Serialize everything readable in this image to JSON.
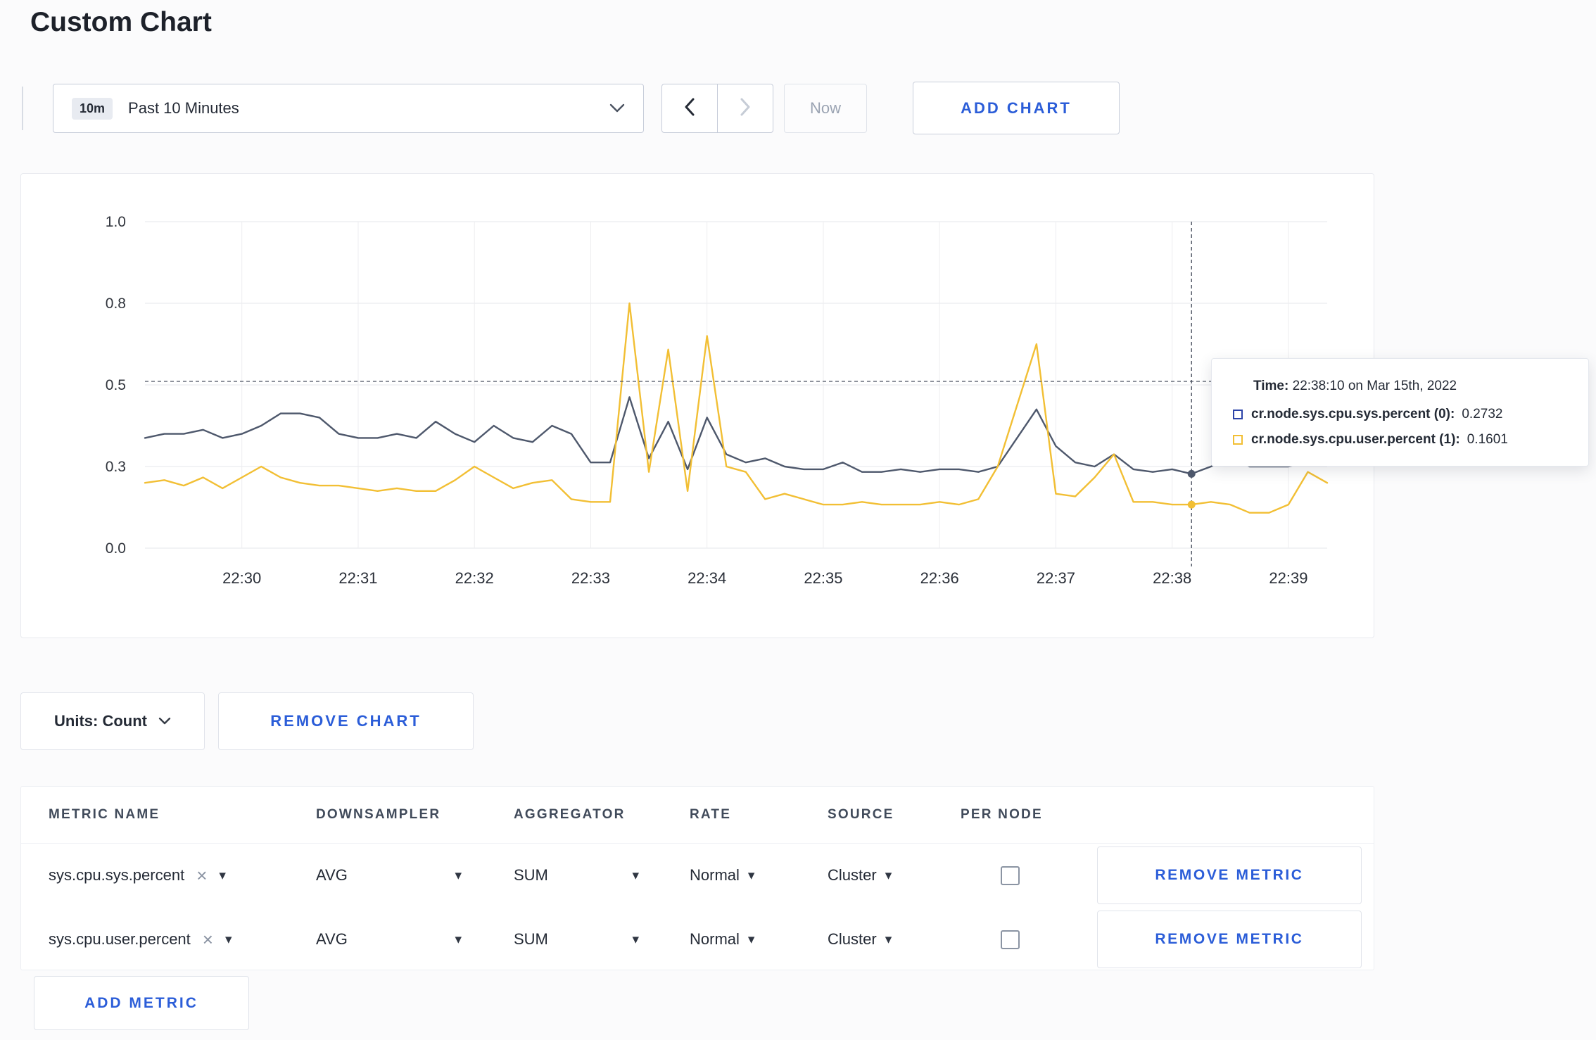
{
  "theme": {
    "accent_blue": "#2b5dd8",
    "page_background": "#fbfbfc",
    "panel_background": "#ffffff"
  },
  "page": {
    "title": "Custom Chart"
  },
  "toolbar": {
    "time_range": {
      "badge": "10m",
      "label": "Past 10 Minutes"
    },
    "now_label": "Now",
    "add_chart_label": "ADD CHART"
  },
  "icons": {
    "close": "×",
    "triangle_down": "▾"
  },
  "chart_data": {
    "type": "line",
    "title": "",
    "xlabel": "",
    "ylabel": "",
    "grid": true,
    "x_ticks": [
      "22:30",
      "22:31",
      "22:32",
      "22:33",
      "22:34",
      "22:35",
      "22:36",
      "22:37",
      "22:38",
      "22:39"
    ],
    "x_tick_seconds": [
      0,
      60,
      120,
      180,
      240,
      300,
      360,
      420,
      480,
      540
    ],
    "x_domain_seconds": [
      -50,
      560
    ],
    "x_start_seconds": -50,
    "x_step_seconds": 10,
    "y_ticks": [
      0,
      0.3,
      0.5,
      0.8,
      1
    ],
    "y_tick_labels": [
      "0.0",
      "0.3",
      "0.5",
      "0.8",
      "1.0"
    ],
    "series": [
      {
        "name": "cr.node.sys.cpu.sys.percent",
        "color": "#4e586c",
        "values": [
          0.37,
          0.38,
          0.38,
          0.39,
          0.37,
          0.38,
          0.4,
          0.43,
          0.43,
          0.42,
          0.38,
          0.37,
          0.37,
          0.38,
          0.37,
          0.41,
          0.38,
          0.36,
          0.4,
          0.37,
          0.36,
          0.4,
          0.38,
          0.31,
          0.31,
          0.47,
          0.32,
          0.41,
          0.29,
          0.42,
          0.33,
          0.31,
          0.32,
          0.3,
          0.29,
          0.29,
          0.31,
          0.28,
          0.28,
          0.29,
          0.28,
          0.29,
          0.29,
          0.28,
          0.3,
          0.37,
          0.44,
          0.35,
          0.31,
          0.3,
          0.33,
          0.29,
          0.28,
          0.29,
          0.2732,
          0.3,
          0.32,
          0.3,
          0.3,
          0.3,
          0.31,
          0.31
        ]
      },
      {
        "name": "cr.node.sys.cpu.user.percent",
        "color": "#f2bf34",
        "values": [
          0.24,
          0.25,
          0.23,
          0.26,
          0.22,
          0.26,
          0.3,
          0.26,
          0.24,
          0.23,
          0.23,
          0.22,
          0.21,
          0.22,
          0.21,
          0.21,
          0.25,
          0.3,
          0.26,
          0.22,
          0.24,
          0.25,
          0.18,
          0.17,
          0.17,
          0.8,
          0.28,
          0.63,
          0.21,
          0.68,
          0.3,
          0.28,
          0.18,
          0.2,
          0.18,
          0.16,
          0.16,
          0.17,
          0.16,
          0.16,
          0.16,
          0.17,
          0.16,
          0.18,
          0.3,
          0.45,
          0.65,
          0.2,
          0.19,
          0.26,
          0.33,
          0.17,
          0.17,
          0.16,
          0.1601,
          0.17,
          0.16,
          0.13,
          0.13,
          0.16,
          0.28,
          0.24
        ]
      }
    ],
    "hover": {
      "x_seconds": 490,
      "line_value": 0.513,
      "points": [
        0.2732,
        0.1601
      ]
    }
  },
  "tooltip": {
    "time_label": "Time:",
    "time_value": "22:38:10 on Mar 15th, 2022",
    "rows": [
      {
        "name": "cr.node.sys.cpu.sys.percent (0):",
        "value": "0.2732",
        "marker_color": "#2c43a8"
      },
      {
        "name": "cr.node.sys.cpu.user.percent (1):",
        "value": "0.1601",
        "marker_color": "#f2bf34"
      }
    ]
  },
  "chart_controls": {
    "units_label": "Units: Count",
    "remove_chart_label": "REMOVE CHART"
  },
  "metrics_table": {
    "headers": [
      "METRIC NAME",
      "DOWNSAMPLER",
      "AGGREGATOR",
      "RATE",
      "SOURCE",
      "PER NODE"
    ],
    "rows": [
      {
        "metric": "sys.cpu.sys.percent",
        "downsampler": "AVG",
        "aggregator": "SUM",
        "rate": "Normal",
        "source": "Cluster",
        "per_node_checked": false,
        "remove_label": "REMOVE METRIC"
      },
      {
        "metric": "sys.cpu.user.percent",
        "downsampler": "AVG",
        "aggregator": "SUM",
        "rate": "Normal",
        "source": "Cluster",
        "per_node_checked": false,
        "remove_label": "REMOVE METRIC"
      }
    ],
    "add_metric_label": "ADD METRIC"
  }
}
